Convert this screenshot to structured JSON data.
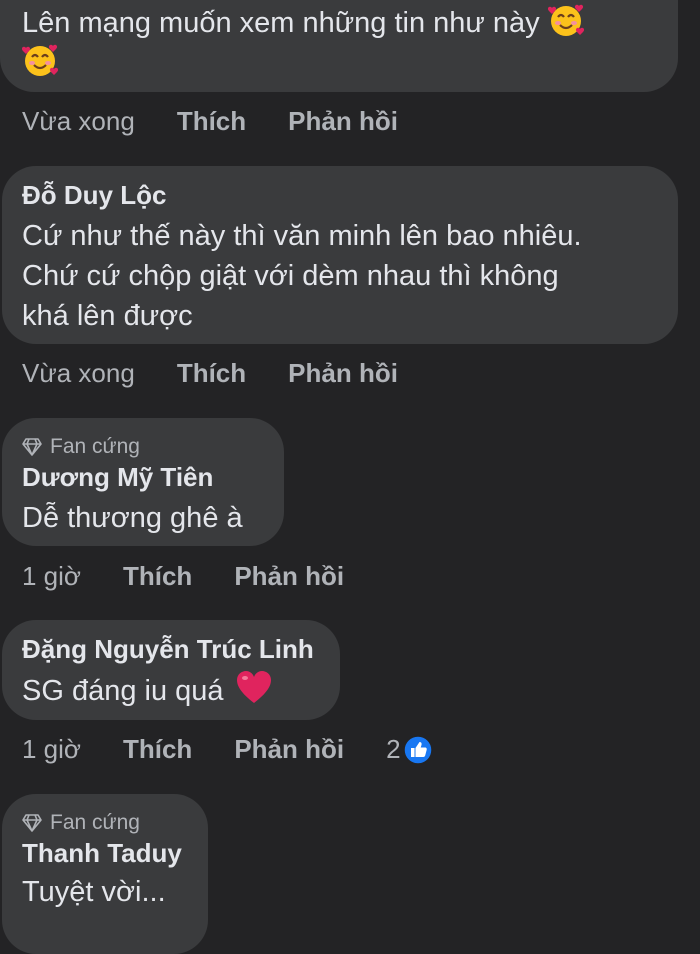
{
  "comments": [
    {
      "text_line1": "Lên mạng muốn xem những tin như này",
      "time": "Vừa xong",
      "like": "Thích",
      "reply": "Phản hồi"
    },
    {
      "author": "Đỗ Duy Lộc",
      "text_lines": [
        "Cứ như thế này thì văn minh lên bao nhiêu.",
        "Chứ cứ chộp giật với dèm nhau thì không",
        "khá lên được"
      ],
      "time": "Vừa xong",
      "like": "Thích",
      "reply": "Phản hồi"
    },
    {
      "badge": "Fan cứng",
      "author": "Dương Mỹ Tiên",
      "text": "Dễ thương ghê à",
      "time": "1 giờ",
      "like": "Thích",
      "reply": "Phản hồi"
    },
    {
      "author": "Đặng Nguyễn Trúc Linh",
      "text": "SG đáng iu quá",
      "time": "1 giờ",
      "like": "Thích",
      "reply": "Phản hồi",
      "reaction_count": "2"
    },
    {
      "badge": "Fan cứng",
      "author": "Thanh Taduy",
      "text": "Tuyệt vời..."
    }
  ],
  "icons": {
    "emoji_smile_hearts": "smiling-face-with-hearts-icon",
    "emoji_heart": "red-heart-icon",
    "badge": "diamond-icon",
    "like_reaction": "like-thumb-icon"
  },
  "colors": {
    "background": "#232325",
    "bubble": "#3a3b3d",
    "text": "#e4e6eb",
    "secondary": "#b0b3b8",
    "like_blue": "#1877f2",
    "heart_red": "#e0245e"
  }
}
